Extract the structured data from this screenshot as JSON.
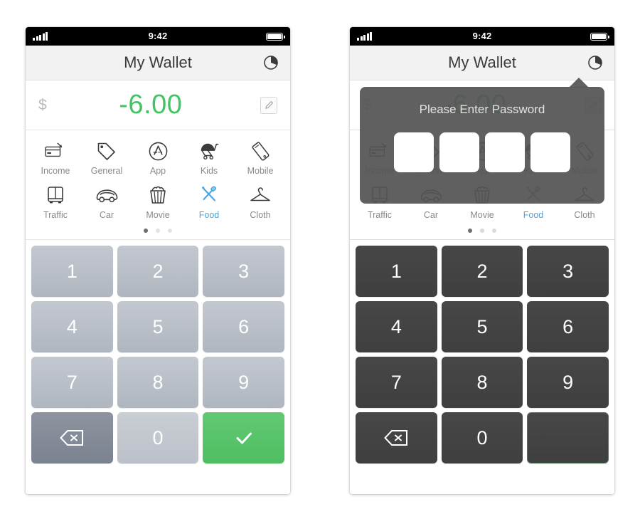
{
  "app": {
    "title": "My Wallet",
    "accent_green": "#42c463",
    "accent_blue": "#4ea3e0",
    "key_gray": "#b0b6bf",
    "key_dark": "#424242",
    "dialog_bg": "#545454"
  },
  "status_bar": {
    "time": "9:42",
    "signal_icon": "signal-bars-icon",
    "battery_icon": "battery-full-icon"
  },
  "nav": {
    "title": "My Wallet",
    "chart_icon": "pie-chart-icon"
  },
  "balance": {
    "currency_symbol": "$",
    "amount": "-6.00",
    "edit_icon": "pencil-edit-icon"
  },
  "categories": {
    "row1": [
      {
        "label": "Income",
        "icon": "credit-card-icon",
        "active": false
      },
      {
        "label": "General",
        "icon": "price-tag-icon",
        "active": false
      },
      {
        "label": "App",
        "icon": "app-store-icon",
        "active": false
      },
      {
        "label": "Kids",
        "icon": "stroller-icon",
        "active": false
      },
      {
        "label": "Mobile",
        "icon": "smartphone-icon",
        "active": false
      }
    ],
    "row2": [
      {
        "label": "Traffic",
        "icon": "train-icon",
        "active": false
      },
      {
        "label": "Car",
        "icon": "car-icon",
        "active": false
      },
      {
        "label": "Movie",
        "icon": "popcorn-icon",
        "active": false
      },
      {
        "label": "Food",
        "icon": "fork-knife-icon",
        "active": true
      },
      {
        "label": "Cloth",
        "icon": "hanger-icon",
        "active": false
      }
    ],
    "page_dots": {
      "count": 3,
      "active_index": 0
    }
  },
  "keypad": {
    "keys": [
      "1",
      "2",
      "3",
      "4",
      "5",
      "6",
      "7",
      "8",
      "9"
    ],
    "delete_label": "",
    "delete_icon": "backspace-delete-icon",
    "zero_label": "0",
    "confirm_label": "",
    "confirm_icon": "checkmark-icon"
  },
  "password_dialog": {
    "title": "Please Enter Password",
    "pin_slots": [
      "",
      "",
      "",
      ""
    ],
    "slot_count": 4
  },
  "panels": {
    "left_name": "wallet-keypad-screen",
    "right_name": "wallet-password-prompt-screen"
  }
}
